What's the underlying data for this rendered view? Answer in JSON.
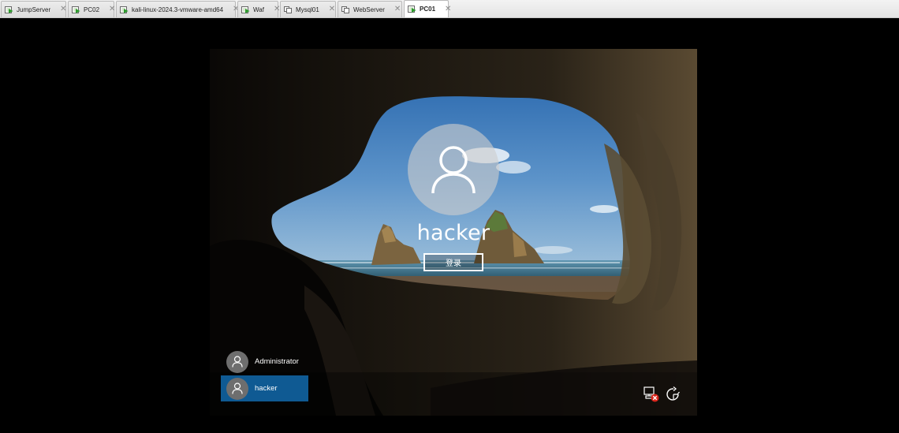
{
  "tabs": [
    {
      "label": "JumpServer",
      "active": false
    },
    {
      "label": "PC02",
      "active": false
    },
    {
      "label": "kali-linux-2024.3-vmware-amd64",
      "active": false
    },
    {
      "label": "Waf",
      "active": false
    },
    {
      "label": "Mysql01",
      "active": false
    },
    {
      "label": "WebServer",
      "active": false
    },
    {
      "label": "PC01",
      "active": true
    }
  ],
  "tab_close_glyph": "✕",
  "login": {
    "username": "hacker",
    "sign_in_label": "登录"
  },
  "users": [
    {
      "name": "Administrator",
      "selected": false
    },
    {
      "name": "hacker",
      "selected": true
    }
  ],
  "icons": {
    "vm": "vm-running-icon",
    "avatar": "user-avatar-icon",
    "network": "network-disconnected-icon",
    "ease_of_access": "ease-of-access-icon"
  },
  "colors": {
    "selected_user_bg": "#0f5a93",
    "tab_active_bg": "#ffffff"
  }
}
